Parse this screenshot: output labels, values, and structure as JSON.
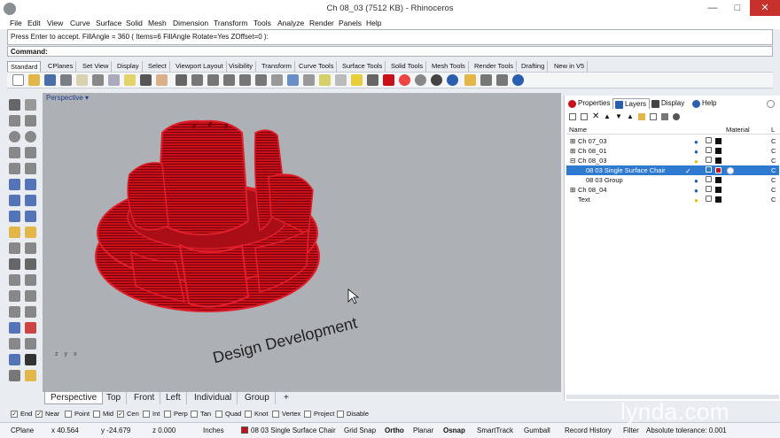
{
  "window": {
    "title": "Ch 08_03 (7512 KB) - Rhinoceros",
    "minimize": "—",
    "maximize": "□",
    "close": "✕"
  },
  "menu": [
    "File",
    "Edit",
    "View",
    "Curve",
    "Surface",
    "Solid",
    "Mesh",
    "Dimension",
    "Transform",
    "Tools",
    "Analyze",
    "Render",
    "Panels",
    "Help"
  ],
  "command": {
    "history": "Press Enter to accept. FillAngle = 360 ( Items=6  FillAngle  Rotate=Yes  ZOffset=0 ):",
    "label": "Command:"
  },
  "toolbar_tabs": [
    "Standard",
    "CPlanes",
    "Set View",
    "Display",
    "Select",
    "Viewport Layout",
    "Visibility",
    "Transform",
    "Curve Tools",
    "Surface Tools",
    "Solid Tools",
    "Mesh Tools",
    "Render Tools",
    "Drafting",
    "New in V5"
  ],
  "viewport": {
    "label": "Perspective",
    "dropdown": "▾",
    "grid_text": "Design Development",
    "axes": "z y x"
  },
  "viewport_tabs": [
    "Perspective",
    "Top",
    "Front",
    "Left",
    "Individual",
    "Group",
    "+"
  ],
  "panel": {
    "tabs": [
      "Properties",
      "Layers",
      "Display",
      "Help"
    ],
    "header": {
      "name": "Name",
      "material": "Material",
      "tail": "L"
    },
    "layers": [
      {
        "expander": "⊞",
        "name": "Ch 07_03",
        "color": "#111111",
        "bulb": "#1a5fb4"
      },
      {
        "expander": "⊞",
        "name": "Ch 08_01",
        "color": "#111111",
        "bulb": "#1a5fb4"
      },
      {
        "expander": "⊟",
        "name": "Ch 08_03",
        "color": "#111111",
        "bulb": "#e5c100"
      },
      {
        "expander": "",
        "name": "08 03 Single Surface Chair",
        "color": "#c8101a",
        "bulb": "",
        "check": "✓",
        "selected": true
      },
      {
        "expander": "",
        "name": "08 03 Group",
        "color": "#111111",
        "bulb": "#1a5fb4"
      },
      {
        "expander": "⊞",
        "name": "Ch 08_04",
        "color": "#111111",
        "bulb": "#1a5fb4"
      },
      {
        "expander": "",
        "name": "Text",
        "color": "#111111",
        "bulb": "#e5c100"
      }
    ]
  },
  "osnaps": [
    {
      "label": "End",
      "checked": true
    },
    {
      "label": "Near",
      "checked": true
    },
    {
      "label": "Point",
      "checked": false
    },
    {
      "label": "Mid",
      "checked": false
    },
    {
      "label": "Cen",
      "checked": true
    },
    {
      "label": "Int",
      "checked": false
    },
    {
      "label": "Perp",
      "checked": false
    },
    {
      "label": "Tan",
      "checked": false
    },
    {
      "label": "Quad",
      "checked": false
    },
    {
      "label": "Knot",
      "checked": false
    },
    {
      "label": "Vertex",
      "checked": false
    },
    {
      "label": "Project",
      "checked": false
    },
    {
      "label": "Disable",
      "checked": false
    }
  ],
  "status": {
    "cplane": "CPlane",
    "x": "x 40.564",
    "y": "y -24.679",
    "z": "z 0.000",
    "units": "Inches",
    "layer": "08 03 Single Surface Chair",
    "layer_color": "#c8101a",
    "toggles": [
      "Grid Snap",
      "Ortho",
      "Planar",
      "Osnap",
      "SmartTrack",
      "Gumball",
      "Record History",
      "Filter"
    ],
    "bold_toggles": [
      "Ortho",
      "Osnap"
    ],
    "tolerance": "Absolute tolerance: 0.001"
  },
  "watermark": "lynda.com",
  "colors": {
    "object": "#c8101a",
    "viewport_bg": "#adb1b6",
    "selection": "#2f7ad1"
  }
}
